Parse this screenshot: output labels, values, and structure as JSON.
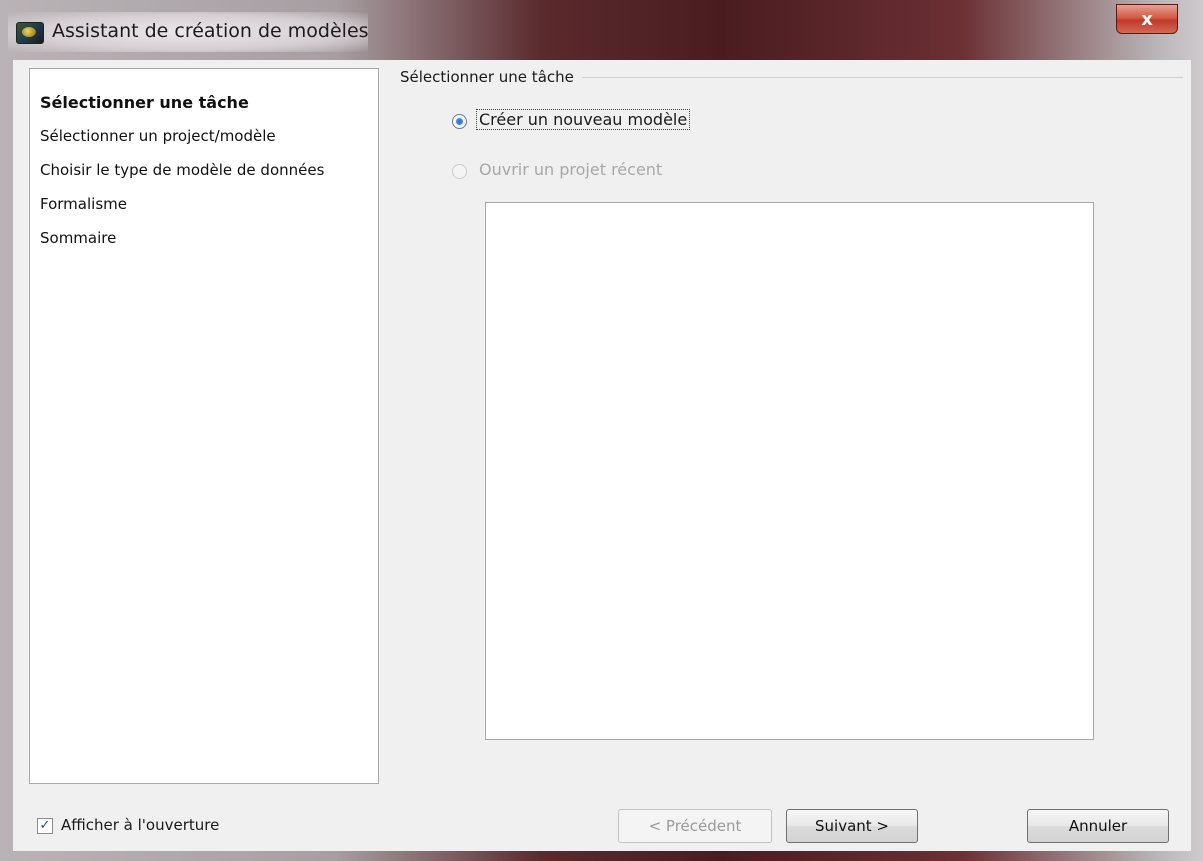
{
  "window": {
    "title": "Assistant de création de modèles",
    "close_label": "x"
  },
  "sidebar": {
    "steps": [
      {
        "label": "Sélectionner une tâche",
        "active": true
      },
      {
        "label": "Sélectionner un project/modèle",
        "active": false
      },
      {
        "label": "Choisir le type de modèle de données",
        "active": false
      },
      {
        "label": "Formalisme",
        "active": false
      },
      {
        "label": "Sommaire",
        "active": false
      }
    ]
  },
  "task_group": {
    "title": "Sélectionner une tâche",
    "options": [
      {
        "label": "Créer un nouveau modèle",
        "selected": true,
        "enabled": true
      },
      {
        "label": "Ouvrir un projet récent",
        "selected": false,
        "enabled": false
      }
    ],
    "recent_projects": []
  },
  "footer": {
    "show_on_open_label": "Afficher à l'ouverture",
    "show_on_open_checked": true,
    "check_glyph": "✓",
    "previous_label": "< Précédent",
    "next_label": "Suivant >",
    "cancel_label": "Annuler"
  }
}
